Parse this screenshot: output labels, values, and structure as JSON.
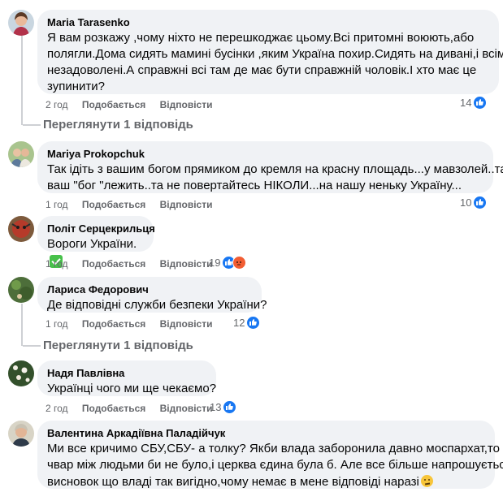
{
  "comments": [
    {
      "author": "Maria Tarasenko",
      "lines": [
        "Я вам розкажу ,чому ніхто не перешкоджає цьому.Всі притомні воюють,або",
        "полягли.Дома сидять мамині бусінки ,яким Україна похир.Сидять на дивані,і всім",
        "незадоволені.А справжні всі там де має бути справжній чоловік.І хто має це",
        "зупинити?"
      ],
      "time": "2 год",
      "like": "Подобається",
      "reply": "Відповісти",
      "react_count": "14",
      "view_replies": "Переглянути 1 відповідь"
    },
    {
      "author": "Mariya Prokopchuk",
      "lines": [
        "Так ідіть з вашим богом прямиком до кремля на красну площадь...у мавзолей..там",
        "ваш \"бог \"лежить..та не повертайтесь НІКОЛИ...на нашу неньку Україну..."
      ],
      "time": "1 год",
      "like": "Подобається",
      "reply": "Відповісти",
      "react_count": "10"
    },
    {
      "author": "Політ Серцекрильця",
      "lines": [
        "Вороги України."
      ],
      "time": "1 год",
      "like": "Подобається",
      "reply": "Відповісти",
      "react_count": "19"
    },
    {
      "author": "Лариса Федорович",
      "lines": [
        "Де відповідні служби безпеки України?"
      ],
      "time": "1 год",
      "like": "Подобається",
      "reply": "Відповісти",
      "react_count": "12",
      "view_replies": "Переглянути 1 відповідь"
    },
    {
      "author": "Надя Павлівна",
      "lines": [
        "Українці чого ми ще чекаємо?"
      ],
      "time": "2 год",
      "like": "Подобається",
      "reply": "Відповісти",
      "react_count": "13"
    },
    {
      "author": "Валентина Аркадіївна Паладійчук",
      "lines": [
        "Ми все кричимо СБУ,СБУ- а толку? Якби влада заборонила давно моспархат,то і",
        "чвар між людьми би не було,і церква єдина була б. Але все більше напрошується",
        "висновок що владі так вигідно,чому немає в мене відповіді наразі"
      ]
    }
  ],
  "colors": {
    "bubble": "#f0f2f5",
    "meta": "#65676b",
    "like_blue": "#1877f2",
    "angry": "#f25d33"
  },
  "icons": {
    "like": "thumbs-up-icon",
    "angry": "angry-face-icon",
    "check": "check-mark-emoji",
    "thinking": "thinking-face-emoji"
  }
}
